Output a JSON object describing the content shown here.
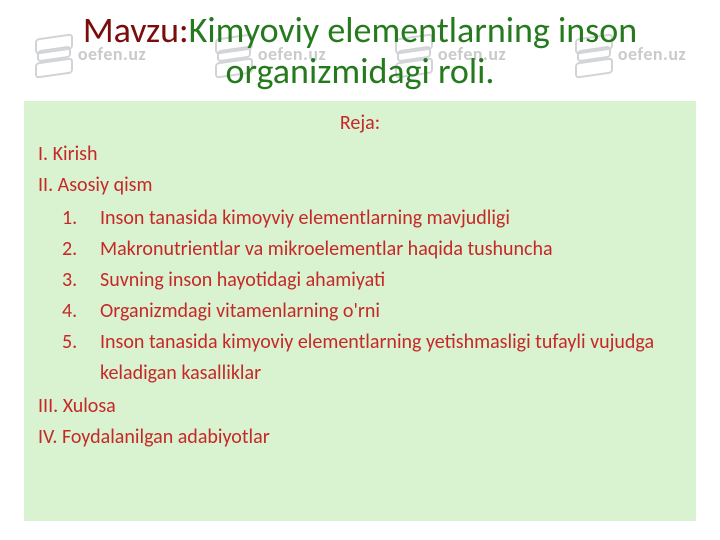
{
  "watermark": {
    "text": "oefen.uz"
  },
  "title": {
    "prefix": "Mavzu:",
    "main": "Kimyoviy elementlarning inson organizmidagi roli."
  },
  "content": {
    "heading": "Reja:",
    "section1": "I. Kirish",
    "section2": "II. Asosiy qism",
    "ordered": [
      {
        "n": "1.",
        "text": "Inson tanasida kimoyviy elementlarning mavjudligi"
      },
      {
        "n": "2.",
        "text": "Makronutrientlar va mikroelementlar haqida tushuncha"
      },
      {
        "n": "3.",
        "text": "Suvning inson hayotidagi ahamiyati"
      },
      {
        "n": "4.",
        "text": "Organizmdagi vitamenlarning o'rni"
      },
      {
        "n": "5.",
        "text": "Inson tanasida kimyoviy elementlarning yetishmasligi tufayli vujudga keladigan kasalliklar"
      }
    ],
    "section3": "III. Xulosa",
    "section4": "IV. Foydalanilgan adabiyotlar"
  }
}
